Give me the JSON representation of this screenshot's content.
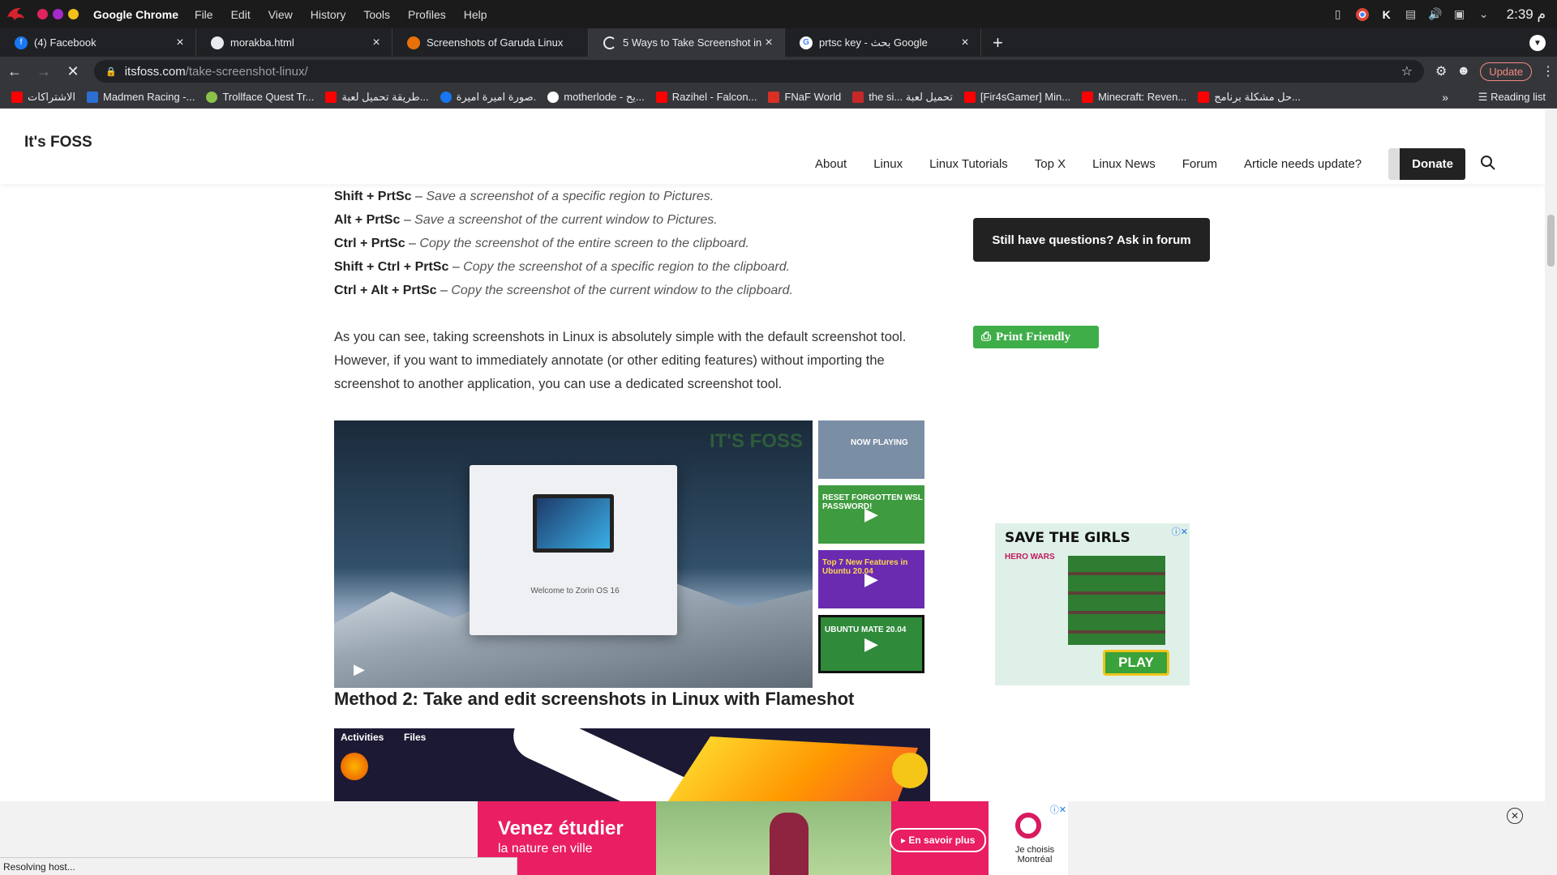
{
  "os_bar": {
    "app_name": "Google Chrome",
    "menu": [
      "File",
      "Edit",
      "View",
      "History",
      "Tools",
      "Profiles",
      "Help"
    ],
    "clock": "2:39 م"
  },
  "tabs": [
    {
      "title": "(4) Facebook",
      "active": false
    },
    {
      "title": "morakba.html",
      "active": false
    },
    {
      "title": "Screenshots of Garuda Linux",
      "active": false
    },
    {
      "title": "5 Ways to Take Screenshot in",
      "active": true
    },
    {
      "title": "prtsc key - بحث Google",
      "active": false
    }
  ],
  "address": {
    "domain": "itsfoss.com",
    "path": "/take-screenshot-linux/",
    "update_label": "Update"
  },
  "bookmarks": [
    "الاشتراكات",
    "Madmen Racing -...",
    "Trollface Quest Tr...",
    "طريقة تحميل لعبة...",
    "صورة اميرة اميرة.",
    "motherlode - يح...",
    "Razihel - Falcon...",
    "FNaF World",
    "the si... تحميل لعبة",
    "[Fir4sGamer] Min...",
    "Minecraft: Reven...",
    "حل مشكلة برنامج..."
  ],
  "reading_list": "Reading list",
  "site": {
    "title": "It's FOSS",
    "nav": [
      "About",
      "Linux",
      "Linux Tutorials",
      "Top X",
      "Linux News",
      "Forum",
      "Article needs update?"
    ],
    "donate": "Donate"
  },
  "shortcuts": [
    {
      "keys": "Shift + PrtSc",
      "desc": "Save a screenshot of a specific region to Pictures."
    },
    {
      "keys": "Alt + PrtSc ",
      "desc": "Save a screenshot of the current window to Pictures."
    },
    {
      "keys": "Ctrl + PrtSc",
      "desc": "Copy the screenshot of the entire screen to the clipboard."
    },
    {
      "keys": "Shift + Ctrl + PrtSc",
      "desc": "Copy the screenshot of a specific region to the clipboard."
    },
    {
      "keys": "Ctrl + Alt + PrtSc",
      "desc": "Copy the screenshot of the current window to the clipboard."
    }
  ],
  "paragraph": "As you can see, taking screenshots in Linux is absolutely simple with the default screenshot tool. However, if you want to immediately annotate (or other editing features) without importing the screenshot to another application, you can use a dedicated screenshot tool.",
  "video": {
    "watermark": "IT'S FOSS",
    "dialog_text": "Welcome to Zorin OS 16"
  },
  "thumbs": [
    {
      "label": "NOW PLAYING",
      "color": "#7a8ea6"
    },
    {
      "label": "RESET FORGOTTEN WSL PASSWORD!",
      "color": "#3f9b3f"
    },
    {
      "label": "Top 7 New Features in Ubuntu 20.04",
      "color": "#6a2bb0"
    },
    {
      "label": "UBUNTU MATE 20.04",
      "color": "#2f8a3a"
    }
  ],
  "method_heading": "Method 2: Take and edit screenshots in Linux with Flameshot",
  "screenshot2": {
    "activities": "Activities",
    "files": "Files"
  },
  "sidebar": {
    "ask_forum": "Still have questions? Ask in forum",
    "print_friendly": "Print Friendly"
  },
  "ad_side": {
    "headline": "SAVE THE GIRLS",
    "brand": "HERO WARS",
    "play": "PLAY"
  },
  "ad_bottom": {
    "headline": "Venez étudier",
    "sub": "la nature en ville",
    "cta": "En savoir plus",
    "brand": "Je choisis Montréal"
  },
  "status_text": "Resolving host..."
}
